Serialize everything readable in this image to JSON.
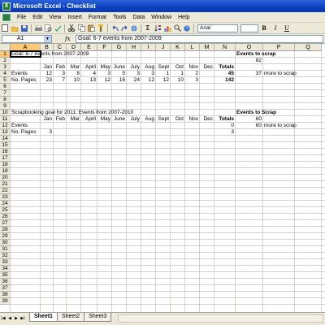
{
  "window": {
    "title": "Microsoft Excel - Checklist",
    "app_badge": "X"
  },
  "menu": [
    "File",
    "Edit",
    "View",
    "Insert",
    "Format",
    "Tools",
    "Data",
    "Window",
    "Help"
  ],
  "toolbar": {
    "font": "Arial",
    "sigma": "Σ",
    "bold": "B",
    "italic": "I",
    "underline": "U"
  },
  "formula_bar": {
    "name_box": "A1",
    "fx": "fx",
    "value": "Goal: 6-7 events from 2007-2009"
  },
  "columns": [
    "A",
    "B",
    "C",
    "D",
    "E",
    "F",
    "G",
    "H",
    "I",
    "J",
    "K",
    "L",
    "M",
    "N",
    "O",
    "P",
    "Q"
  ],
  "rows": [
    "1",
    "2",
    "3",
    "4",
    "5",
    "6",
    "7",
    "8",
    "9",
    "10",
    "11",
    "12",
    "13",
    "14",
    "15",
    "16",
    "17",
    "18",
    "19",
    "20",
    "21",
    "22",
    "23",
    "24",
    "25",
    "26",
    "27",
    "28",
    "29",
    "30",
    "31",
    "32",
    "33",
    "34",
    "35",
    "36",
    "37",
    "38",
    "39"
  ],
  "cells": {
    "a1": "Goal: 6-7 events from 2007-2009",
    "o1": "Events to scrap",
    "o2": "82",
    "months": [
      "Jan",
      "Feb",
      "Mar",
      "April",
      "May",
      "June",
      "July",
      "Aug",
      "Sept",
      "Oct",
      "Nov",
      "Dec"
    ],
    "totals_label": "Totals",
    "events_label": "Events",
    "pages_label": "No. Pages",
    "events_2009": [
      "12",
      "3",
      "8",
      "4",
      "3",
      "5",
      "3",
      "3",
      "1",
      "1",
      "2"
    ],
    "events_total": "45",
    "o4": "37",
    "p4": "more to scrap",
    "pages_2009": [
      "23",
      "7",
      "10",
      "13",
      "12",
      "16",
      "24",
      "12",
      "12",
      "10",
      "3"
    ],
    "pages_total": "142",
    "a10": "Scrapbooking goal for 2011: Events from 2007-2010",
    "o10": "Events to Scrap",
    "o11": "60",
    "n12": "0",
    "o12": "60",
    "p12": "more to scrap",
    "b13": "3",
    "n13": "3"
  },
  "sheets": [
    "Sheet1",
    "Sheet2",
    "Sheet3"
  ],
  "tab_nav": [
    "|◀",
    "◀",
    "▶",
    "▶|"
  ]
}
